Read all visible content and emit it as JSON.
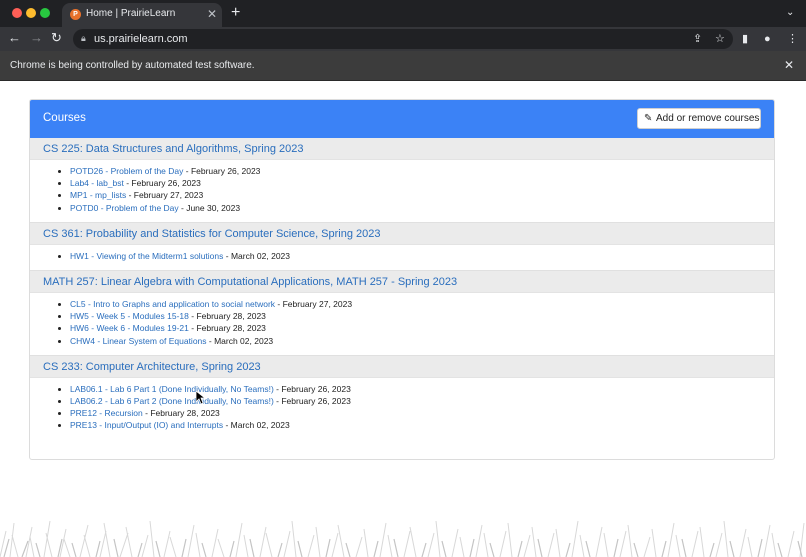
{
  "browser": {
    "tab_title": "Home | PrairieLearn",
    "favicon_letter": "P",
    "url": "us.prairielearn.com",
    "infobar_text": "Chrome is being controlled by automated test software."
  },
  "card": {
    "title": "Courses",
    "add_button_label": "Add or remove courses"
  },
  "courses": [
    {
      "name": "CS 225: Data Structures and Algorithms, Spring 2023",
      "assessments": [
        {
          "label": "POTD26 - Problem of the Day",
          "date": " - February 26, 2023"
        },
        {
          "label": "Lab4 - lab_bst",
          "date": " - February 26, 2023"
        },
        {
          "label": "MP1 - mp_lists",
          "date": " - February 27, 2023"
        },
        {
          "label": "POTD0 - Problem of the Day",
          "date": " - June 30, 2023"
        }
      ]
    },
    {
      "name": "CS 361: Probability and Statistics for Computer Science, Spring 2023",
      "assessments": [
        {
          "label": "HW1 - Viewing of the Midterm1 solutions",
          "date": " - March 02, 2023"
        }
      ]
    },
    {
      "name": "MATH 257: Linear Algebra with Computational Applications, MATH 257 - Spring 2023",
      "assessments": [
        {
          "label": "CL5 - Intro to Graphs and application to social network",
          "date": " - February 27, 2023"
        },
        {
          "label": "HW5 - Week 5 - Modules 15-18",
          "date": " - February 28, 2023"
        },
        {
          "label": "HW6 - Week 6 - Modules 19-21",
          "date": " - February 28, 2023"
        },
        {
          "label": "CHW4 - Linear System of Equations",
          "date": " - March 02, 2023"
        }
      ]
    },
    {
      "name": "CS 233: Computer Architecture, Spring 2023",
      "assessments": [
        {
          "label": "LAB06.1 - Lab 6 Part 1 (Done Individually, No Teams!)",
          "date": " - February 26, 2023"
        },
        {
          "label": "LAB06.2 - Lab 6 Part 2 (Done Individually, No Teams!)",
          "date": " - February 26, 2023"
        },
        {
          "label": "PRE12 - Recursion",
          "date": " - February 28, 2023"
        },
        {
          "label": "PRE13 - Input/Output (IO) and Interrupts",
          "date": " - March 02, 2023"
        }
      ]
    }
  ],
  "colors": {
    "header_blue": "#3b82f6",
    "link_blue": "#2a6ebd",
    "chrome_dark": "#202124"
  }
}
